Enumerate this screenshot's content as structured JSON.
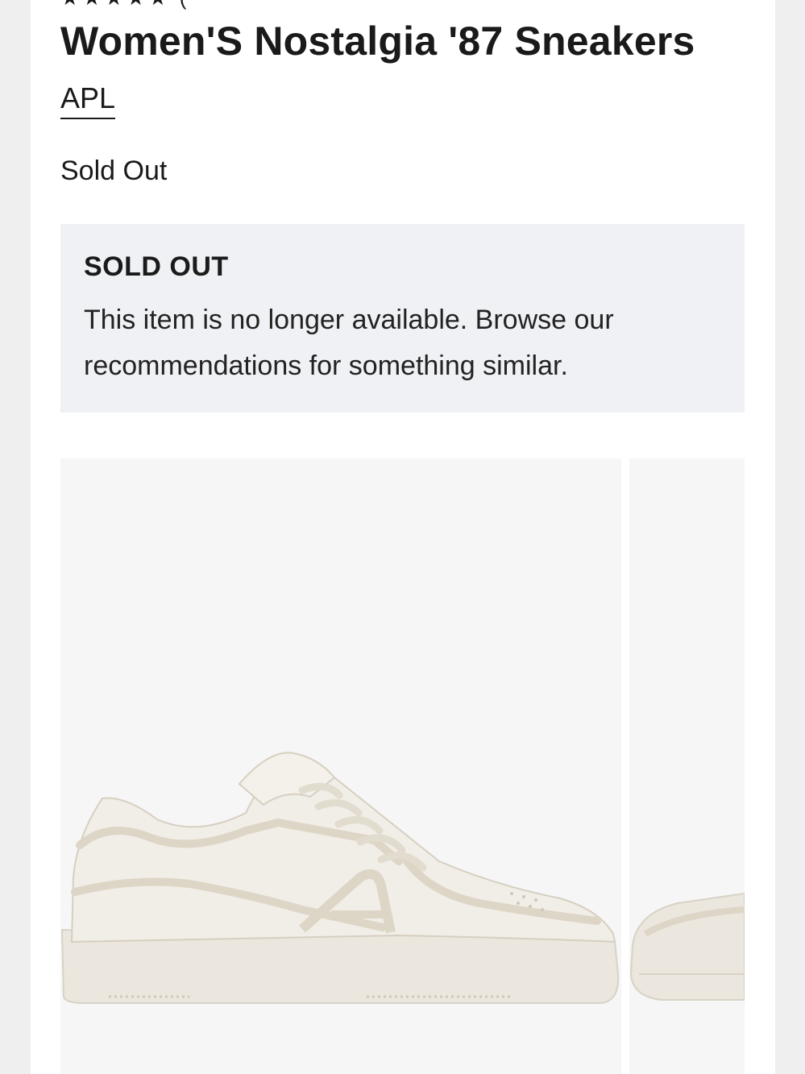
{
  "product": {
    "rating_stars": "★★★★★ (",
    "title": "Women'S Nostalgia '87 Sneakers",
    "brand": "APL",
    "availability": "Sold Out"
  },
  "notice": {
    "heading": "SOLD OUT",
    "body": "This item is no longer available. Browse our recommendations for something similar."
  },
  "gallery": {
    "images": [
      {
        "name": "main-product-photo",
        "icon": "sneaker-side-view"
      },
      {
        "name": "next-product-photo",
        "icon": "sneaker-front-view"
      }
    ]
  },
  "colors": {
    "notice_bg": "#f0f1f4",
    "photo_bg": "#f6f6f6",
    "shoe_cream": "#ebe7de"
  }
}
